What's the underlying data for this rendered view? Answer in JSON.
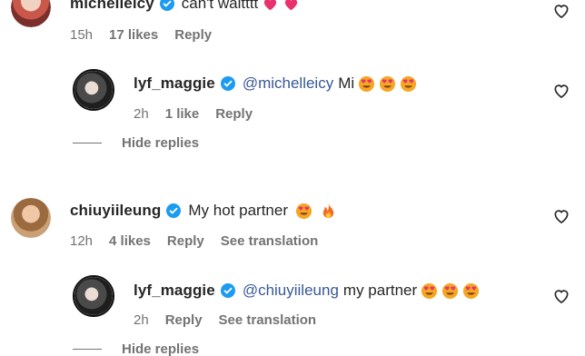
{
  "comments": [
    {
      "username": "michelleicy",
      "text": "can't waitttt",
      "emojis": [
        "heart-emoji",
        "heart-emoji"
      ],
      "meta": {
        "time": "15h",
        "likes": "17 likes",
        "reply": "Reply"
      }
    },
    {
      "username": "lyf_maggie",
      "mention": "@michelleicy",
      "text": "Mi",
      "emojis": [
        "heart-eyes-emoji",
        "heart-eyes-emoji",
        "heart-eyes-emoji"
      ],
      "meta": {
        "time": "2h",
        "likes": "1 like",
        "reply": "Reply"
      },
      "hide_replies": "Hide replies"
    },
    {
      "username": "chiuyiileung",
      "text": "My hot partner",
      "emojis": [
        "heart-eyes-emoji",
        "fire-emoji"
      ],
      "meta": {
        "time": "12h",
        "likes": "4 likes",
        "reply": "Reply",
        "translate": "See translation"
      }
    },
    {
      "username": "lyf_maggie",
      "mention": "@chiuyiileung",
      "text": "my partner",
      "emojis": [
        "heart-eyes-emoji",
        "heart-eyes-emoji",
        "heart-eyes-emoji"
      ],
      "meta": {
        "time": "2h",
        "reply": "Reply",
        "translate": "See translation"
      },
      "hide_replies": "Hide replies"
    }
  ],
  "colors": {
    "username": "#262626",
    "mention": "#385898",
    "meta": "#737373",
    "verified": "#1d9bf0"
  }
}
